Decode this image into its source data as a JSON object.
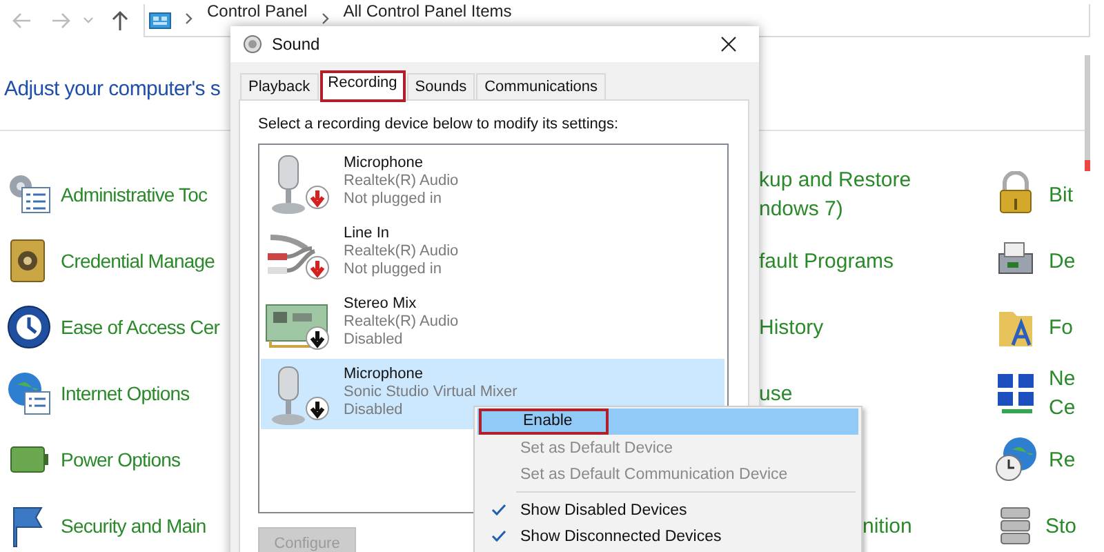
{
  "nav": {
    "address": [
      "Control Panel",
      "All Control Panel Items"
    ]
  },
  "heading": "Adjust your computer's s",
  "column_1": [
    {
      "label": "Administrative Toc"
    },
    {
      "label": "Credential Manage"
    },
    {
      "label": "Ease of Access Cer"
    },
    {
      "label": "Internet Options"
    },
    {
      "label": "Power Options"
    },
    {
      "label": "Security and Main"
    }
  ],
  "column_2": [
    {
      "lines": [
        "kup and Restore",
        "ndows 7)"
      ]
    },
    {
      "lines": [
        "fault Programs"
      ]
    },
    {
      "lines": [
        "History"
      ]
    },
    {
      "lines": [
        "use"
      ]
    },
    {
      "lines": [
        "nition"
      ]
    }
  ],
  "column_3": [
    {
      "lines": [
        "Bit"
      ]
    },
    {
      "lines": [
        "De"
      ]
    },
    {
      "lines": [
        "Fo"
      ]
    },
    {
      "lines": [
        "Ne",
        "Ce"
      ]
    },
    {
      "lines": [
        "Re"
      ]
    },
    {
      "lines": [
        "Sto"
      ]
    }
  ],
  "dialog": {
    "title": "Sound",
    "tabs": [
      {
        "label": "Playback",
        "selected": false,
        "marked": false
      },
      {
        "label": "Recording",
        "selected": true,
        "marked": true
      },
      {
        "label": "Sounds",
        "selected": false,
        "marked": false
      },
      {
        "label": "Communications",
        "selected": false,
        "marked": false
      }
    ],
    "instruction": "Select a recording device below to modify its settings:",
    "devices": [
      {
        "kind": "microphone",
        "name": "Microphone",
        "driver": "Realtek(R) Audio",
        "status": "Not plugged in",
        "connected": false,
        "selected": false
      },
      {
        "kind": "line-in",
        "name": "Line In",
        "driver": "Realtek(R) Audio",
        "status": "Not plugged in",
        "connected": false,
        "selected": false
      },
      {
        "kind": "card",
        "name": "Stereo Mix",
        "driver": "Realtek(R) Audio",
        "status": "Disabled",
        "connected": true,
        "selected": false
      },
      {
        "kind": "microphone",
        "name": "Microphone",
        "driver": "Sonic Studio Virtual Mixer",
        "status": "Disabled",
        "connected": true,
        "selected": true
      }
    ],
    "buttons": [
      {
        "label": "Configure",
        "disabled": true
      }
    ]
  },
  "context_menu": {
    "items": [
      {
        "kind": "item",
        "label": "Enable",
        "selected": true,
        "marked": true,
        "disabled": false,
        "checked": false
      },
      {
        "kind": "item",
        "label": "Set as Default Device",
        "selected": false,
        "marked": false,
        "disabled": true,
        "checked": false
      },
      {
        "kind": "item",
        "label": "Set as Default Communication Device",
        "selected": false,
        "marked": false,
        "disabled": true,
        "checked": false
      },
      {
        "kind": "separator"
      },
      {
        "kind": "item",
        "label": "Show Disabled Devices",
        "selected": false,
        "marked": false,
        "disabled": false,
        "checked": true
      },
      {
        "kind": "item",
        "label": "Show Disconnected Devices",
        "selected": false,
        "marked": false,
        "disabled": false,
        "checked": true
      }
    ]
  }
}
